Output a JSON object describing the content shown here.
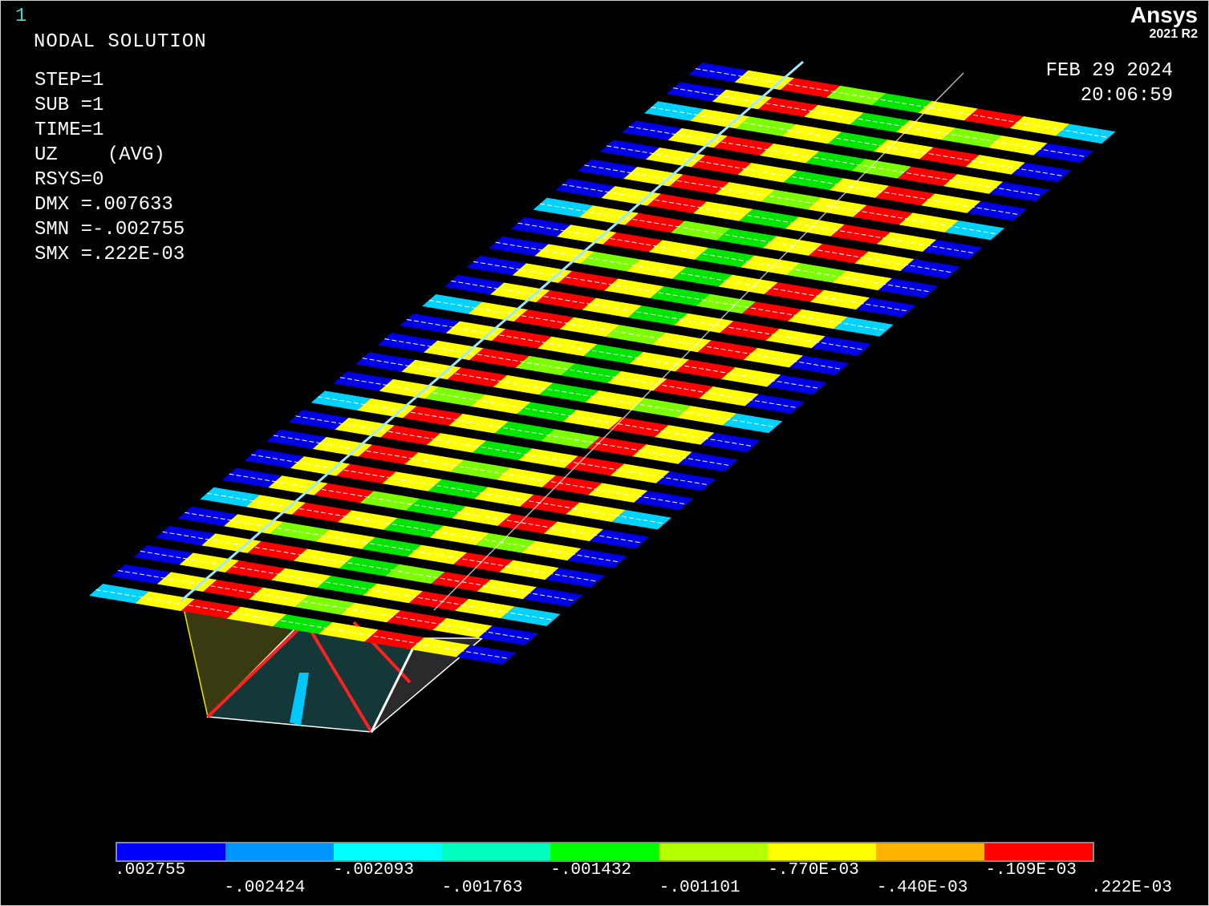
{
  "header": {
    "window_number": "1",
    "title": "NODAL SOLUTION"
  },
  "info": {
    "step": "STEP=1",
    "sub": "SUB =1",
    "time": "TIME=1",
    "quantity": "UZ",
    "averaging": "(AVG)",
    "rsys": "RSYS=0",
    "dmx": "DMX =.007633",
    "smn": "SMN =-.002755",
    "smx": "SMX =.222E-03"
  },
  "brand": {
    "name": "Ansys",
    "version": "2021 R2"
  },
  "timestamp": {
    "date": "FEB 29 2024",
    "time": "20:06:59"
  },
  "legend": {
    "colors": [
      "#0000ff",
      "#0096ff",
      "#00ffff",
      "#00ffbe",
      "#00ff00",
      "#b4ff00",
      "#ffff00",
      "#ffb400",
      "#ff0000"
    ],
    "tick_labels": [
      ".002755",
      "-.002424",
      "-.002093",
      "-.001763",
      "-.001432",
      "-.001101",
      "-.770E-03",
      "-.440E-03",
      "-.109E-03",
      ".222E-03"
    ]
  },
  "model": {
    "rib_count": 28,
    "band_colors": [
      "#0000e6",
      "#ffff00",
      "#ff0000",
      "#ffff00",
      "#00e600",
      "#ffff00",
      "#ff0000",
      "#ffff00",
      "#0000e6"
    ]
  }
}
